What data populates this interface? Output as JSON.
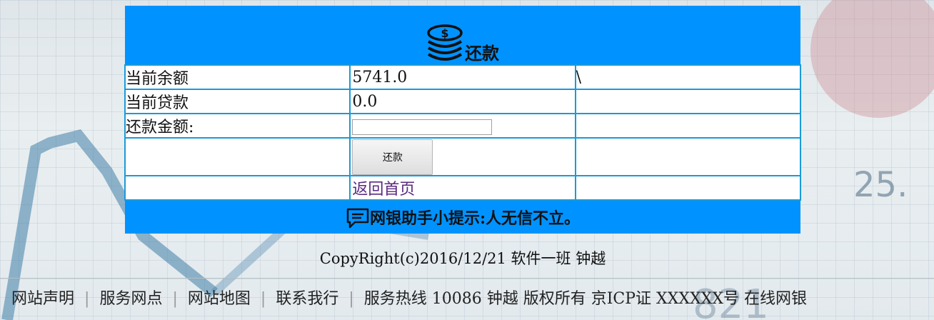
{
  "panel": {
    "title": "还款",
    "rows": [
      {
        "label": "当前余额",
        "value": "5741.0",
        "extra": "\\"
      },
      {
        "label": "当前贷款",
        "value": "0.0",
        "extra": ""
      },
      {
        "label": "还款金额:",
        "value": "",
        "extra": ""
      }
    ],
    "amount_input": {
      "value": "",
      "placeholder": ""
    },
    "pay_button_label": "还款",
    "home_link": "返回首页",
    "tip": "网银助手小提示:人无信不立。"
  },
  "copyright": "CopyRight(c)2016/12/21 软件一班 钟越",
  "footer": {
    "links": [
      "网站声明",
      "服务网点",
      "网站地图",
      "联系我行"
    ],
    "info": "服务热线 10086 钟越 版权所有  京ICP证 XXXXXX号 在线网银"
  },
  "colors": {
    "panel_header": "#0093ff",
    "border": "#1a9ad8",
    "link": "#5a2a82"
  },
  "icons": {
    "title_icon": "coins-icon",
    "tip_icon": "chat-bubble-icon"
  }
}
